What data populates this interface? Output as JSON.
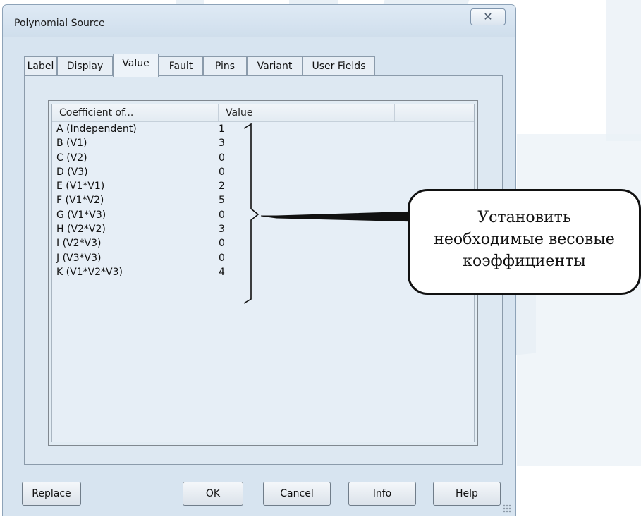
{
  "window": {
    "title": "Polynomial Source",
    "close_symbol": "✕"
  },
  "tabs": [
    {
      "label": "Label",
      "active": false
    },
    {
      "label": "Display",
      "active": false
    },
    {
      "label": "Value",
      "active": true
    },
    {
      "label": "Fault",
      "active": false
    },
    {
      "label": "Pins",
      "active": false
    },
    {
      "label": "Variant",
      "active": false
    },
    {
      "label": "User Fields",
      "active": false
    }
  ],
  "table": {
    "headers": [
      "Coefficient of...",
      "Value"
    ],
    "rows": [
      {
        "coefficient": "A (Independent)",
        "value": "1"
      },
      {
        "coefficient": "B (V1)",
        "value": "3"
      },
      {
        "coefficient": "C (V2)",
        "value": "0"
      },
      {
        "coefficient": "D (V3)",
        "value": "0"
      },
      {
        "coefficient": "E (V1*V1)",
        "value": "2"
      },
      {
        "coefficient": "F (V1*V2)",
        "value": "5"
      },
      {
        "coefficient": "G (V1*V3)",
        "value": "0"
      },
      {
        "coefficient": "H (V2*V2)",
        "value": "3"
      },
      {
        "coefficient": "I (V2*V3)",
        "value": "0"
      },
      {
        "coefficient": "J (V3*V3)",
        "value": "0"
      },
      {
        "coefficient": "K (V1*V2*V3)",
        "value": "4"
      }
    ]
  },
  "callout": {
    "text": "Установить\nнеобходимые весовые\nкоэффициенты"
  },
  "buttons": {
    "replace": "Replace",
    "ok": "OK",
    "cancel": "Cancel",
    "info": "Info",
    "help": "Help"
  }
}
